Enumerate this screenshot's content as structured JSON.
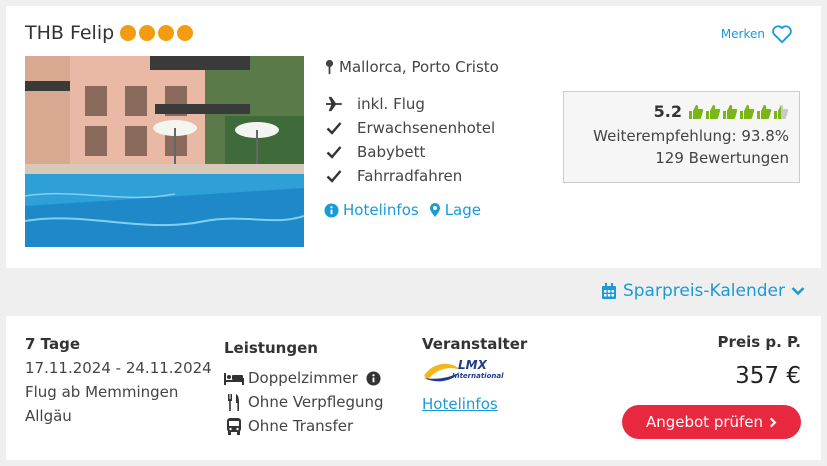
{
  "hotel": {
    "name": "THB Felip",
    "stars": 4,
    "merken_label": "Merken",
    "location": "Mallorca, Porto Cristo",
    "features": [
      {
        "icon": "plane-icon",
        "label": "inkl. Flug"
      },
      {
        "icon": "check-icon",
        "label": "Erwachsenenhotel"
      },
      {
        "icon": "check-icon",
        "label": "Babybett"
      },
      {
        "icon": "check-icon",
        "label": "Fahrradfahren"
      }
    ],
    "links": {
      "hotelinfos": "Hotelinfos",
      "lage": "Lage"
    },
    "rating": {
      "score": "5.2",
      "thumbs_filled": 5.5,
      "thumbs_total": 6,
      "recommendation": "Weiterempfehlung: 93.8%",
      "reviews": "129 Bewertungen"
    }
  },
  "calendar_label": "Sparpreis-Kalender",
  "offer": {
    "duration": "7 Tage",
    "dates": "17.11.2024 - 24.11.2024",
    "flight_line1": "Flug ab Memmingen",
    "flight_line2": "Allgäu",
    "services_head": "Leistungen",
    "services": [
      {
        "icon": "bed-icon",
        "label": "Doppelzimmer",
        "info": true
      },
      {
        "icon": "cutlery-icon",
        "label": "Ohne Verpflegung"
      },
      {
        "icon": "bus-icon",
        "label": "Ohne Transfer"
      }
    ],
    "operator_head": "Veranstalter",
    "operator_logo_text": "LMX",
    "operator_logo_subtext": "International",
    "operator_link": "Hotelinfos",
    "price_label": "Preis p. P.",
    "price": "357 €",
    "cta_label": "Angebot prüfen"
  },
  "colors": {
    "accent": "#1a9ad6",
    "cta": "#e8283f",
    "stars": "#f39c12",
    "thumbs": "#7cb518"
  }
}
